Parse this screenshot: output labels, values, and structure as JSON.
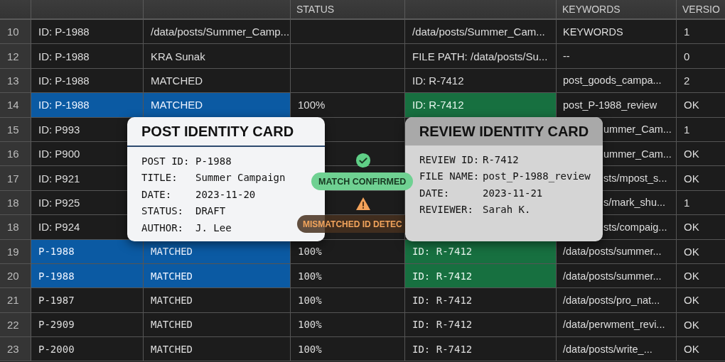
{
  "table": {
    "header": {
      "status": "STATUS",
      "keywords": "KEYWORDS",
      "version": "VERSIO"
    },
    "rows": [
      {
        "number": "10",
        "kind": "sans",
        "selected": false,
        "covered": false,
        "column_1": "ID: P-1988",
        "column_2": "/data/posts/Summer_Camp...",
        "column_4": "/data/posts/Summer_Cam...",
        "keywords": "KEYWORDS",
        "version": "1"
      },
      {
        "number": "12",
        "kind": "sans",
        "selected": false,
        "covered": false,
        "column_1": "ID: P-1988",
        "column_2": "KRA Sunak",
        "column_4": "FILE PATH: /data/posts/Su...",
        "keywords": "--",
        "version": "0"
      },
      {
        "number": "13",
        "kind": "sans",
        "selected": false,
        "covered": false,
        "column_1": "ID: P-1988",
        "column_2": "MATCHED",
        "column_4": "ID: R-7412",
        "keywords": "post_goods_campa...",
        "version": "2"
      },
      {
        "number": "14",
        "kind": "sans",
        "selected": true,
        "covered": false,
        "column_1": "ID: P-1988",
        "column_2": "MATCHED",
        "status": "100%",
        "column_4": "ID: R-7412",
        "keywords": "post_P-1988_review",
        "version": "OK"
      },
      {
        "number": "15",
        "kind": "sans",
        "selected": false,
        "covered": true,
        "column_1": "ID: P993",
        "keywords": "ummer_Cam...",
        "version": "1"
      },
      {
        "number": "16",
        "kind": "sans",
        "selected": false,
        "covered": true,
        "column_1": "ID: P900",
        "keywords": "ummer_Cam...",
        "version": "OK"
      },
      {
        "number": "17",
        "kind": "sans",
        "selected": false,
        "covered": true,
        "column_1": "ID: P921",
        "keywords": "sts/mpost_s...",
        "version": "OK"
      },
      {
        "number": "18",
        "kind": "sans",
        "selected": false,
        "covered": true,
        "column_1": "ID: P925",
        "keywords": "s/mark_shu...",
        "version": "1"
      },
      {
        "number": "18",
        "kind": "sans",
        "selected": false,
        "covered": true,
        "column_1": "ID: P924",
        "keywords": "sts/compaig...",
        "version": "OK"
      },
      {
        "number": "19",
        "kind": "mono",
        "selected": true,
        "covered": false,
        "column_1": "P-1988",
        "column_2": "MATCHED",
        "status": "100%",
        "column_4": "ID: R-7412",
        "keywords": "/data/posts/summer...",
        "version": "OK"
      },
      {
        "number": "20",
        "kind": "mono",
        "selected": true,
        "covered": false,
        "column_1": "P-1988",
        "column_2": "MATCHED",
        "status": "100%",
        "column_4": "ID: R-7412",
        "keywords": "/data/posts/summer...",
        "version": "OK"
      },
      {
        "number": "21",
        "kind": "mono",
        "selected": false,
        "covered": false,
        "column_1": "P-1987",
        "column_2": "MATCHED",
        "status": "100%",
        "column_4": "ID: R-7412",
        "keywords": "/data/posts/pro_nat...",
        "version": "OK"
      },
      {
        "number": "22",
        "kind": "mono",
        "selected": false,
        "covered": false,
        "column_1": "P-2909",
        "column_2": "MATCHED",
        "status": "100%",
        "column_4": "ID: R-7412",
        "keywords": "/data/perwment_revi...",
        "version": "OK"
      },
      {
        "number": "23",
        "kind": "mono",
        "selected": false,
        "covered": false,
        "column_1": "P-2000",
        "column_2": "MATCHED",
        "status": "100%",
        "column_4": "ID: R-7412",
        "keywords": "/data/posts/write_...",
        "version": "OK"
      }
    ]
  },
  "post_card": {
    "title": "POST IDENTITY CARD",
    "fields": [
      {
        "label": "POST ID:",
        "value": "P-1988"
      },
      {
        "label": "TITLE:",
        "value": "Summer Campaign"
      },
      {
        "label": "DATE:",
        "value": "2023-11-20"
      },
      {
        "label": "STATUS:",
        "value": "DRAFT"
      },
      {
        "label": "AUTHOR:",
        "value": "J. Lee"
      }
    ]
  },
  "match_badge": {
    "label": "MATCH CONFIRMED"
  },
  "mismatch_badge": {
    "label": "MISMATCHED ID DETEC"
  },
  "review_card": {
    "title": "REVIEW IDENTITY CARD",
    "fields": [
      {
        "label": "REVIEW ID:",
        "value": "R-7412"
      },
      {
        "label": "FILE NAME:",
        "value": "post_P-1988_review"
      },
      {
        "label": "DATE:",
        "value": "2023-11-21"
      },
      {
        "label": "REVIEWER:",
        "value": "Sarah K."
      }
    ]
  }
}
